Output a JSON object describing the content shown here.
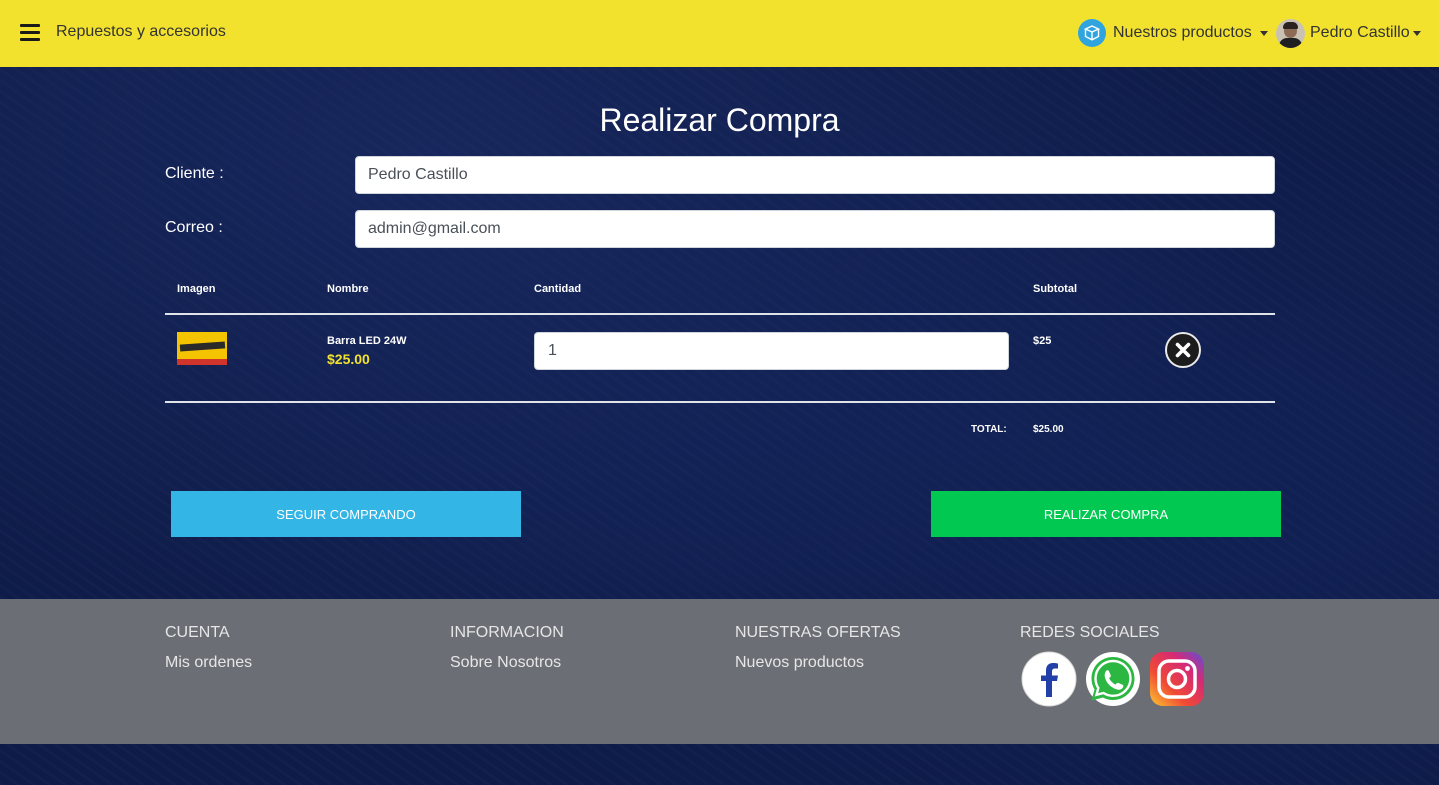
{
  "navbar": {
    "brand": "Repuestos y accesorios",
    "products_label": "Nuestros productos",
    "user_name": "Pedro Castillo"
  },
  "page": {
    "title": "Realizar Compra"
  },
  "form": {
    "client_label": "Cliente :",
    "client_value": "Pedro Castillo",
    "email_label": "Correo :",
    "email_value": "admin@gmail.com"
  },
  "cart": {
    "headers": {
      "image": "Imagen",
      "name": "Nombre",
      "quantity": "Cantidad",
      "subtotal": "Subtotal"
    },
    "items": [
      {
        "name": "Barra LED 24W",
        "price": "$25.00",
        "quantity": "1",
        "subtotal": "$25"
      }
    ],
    "total_label": "TOTAL:",
    "total_value": "$25.00"
  },
  "actions": {
    "continue_label": "SEGUIR COMPRANDO",
    "buy_label": "REALIZAR COMPRA"
  },
  "footer": {
    "columns": [
      {
        "title": "CUENTA",
        "link": "Mis ordenes"
      },
      {
        "title": "INFORMACION",
        "link": "Sobre Nosotros"
      },
      {
        "title": "NUESTRAS OFERTAS",
        "link": "Nuevos productos"
      },
      {
        "title": "REDES SOCIALES"
      }
    ],
    "social_icons": [
      "facebook-icon",
      "whatsapp-icon",
      "instagram-icon"
    ]
  },
  "colors": {
    "navbar": "#f2e22e",
    "background": "#0d1a45",
    "continue_button": "#33b5e5",
    "buy_button": "#00c851",
    "footer": "#6c6e75",
    "price": "#f2e22e"
  }
}
